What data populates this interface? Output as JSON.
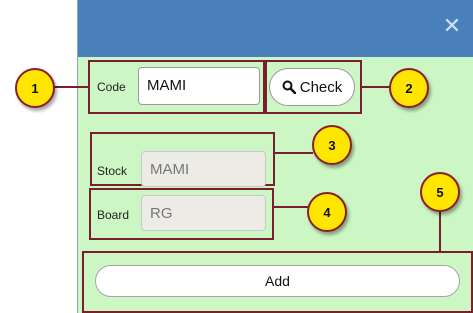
{
  "dialog": {
    "close_icon": "close-icon"
  },
  "form": {
    "code_label": "Code",
    "code_value": "MAMI",
    "check_label": "Check",
    "stock_label": "Stock",
    "stock_value": "MAMI",
    "board_label": "Board",
    "board_value": "RG",
    "add_label": "Add"
  },
  "callouts": [
    "1",
    "2",
    "3",
    "4",
    "5"
  ],
  "colors": {
    "titlebar": "#4a80ba",
    "background": "#ccf7c4",
    "callout_fill": "#ffe600",
    "callout_border": "#7a1d2e"
  }
}
